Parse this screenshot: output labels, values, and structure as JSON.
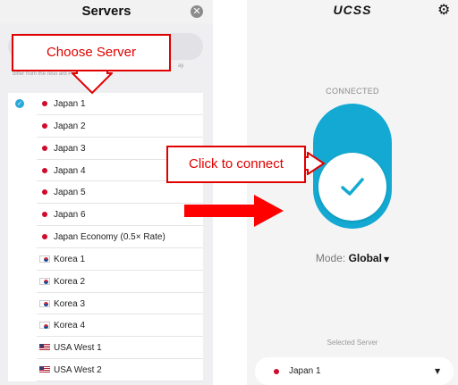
{
  "left_panel": {
    "title": "Servers",
    "close_glyph": "✕",
    "hint_line1_end": "ay",
    "hint_line2": "differ from the resu          ard Ping tests."
  },
  "servers": [
    {
      "name": "Japan 1",
      "flag": "jp",
      "selected": true
    },
    {
      "name": "Japan 2",
      "flag": "jp",
      "selected": false
    },
    {
      "name": "Japan 3",
      "flag": "jp",
      "selected": false
    },
    {
      "name": "Japan 4",
      "flag": "jp",
      "selected": false
    },
    {
      "name": "Japan 5",
      "flag": "jp",
      "selected": false
    },
    {
      "name": "Japan 6",
      "flag": "jp",
      "selected": false
    },
    {
      "name": "Japan Economy (0.5× Rate)",
      "flag": "jp",
      "selected": false
    },
    {
      "name": "Korea 1",
      "flag": "kr",
      "selected": false
    },
    {
      "name": "Korea 2",
      "flag": "kr",
      "selected": false
    },
    {
      "name": "Korea 3",
      "flag": "kr",
      "selected": false
    },
    {
      "name": "Korea 4",
      "flag": "kr",
      "selected": false
    },
    {
      "name": "USA West 1",
      "flag": "us",
      "selected": false
    },
    {
      "name": "USA West 2",
      "flag": "us",
      "selected": false
    }
  ],
  "right_panel": {
    "brand": "UCSS",
    "status": "CONNECTED",
    "mode_label": "Mode:",
    "mode_value": "Global",
    "selected_server_label": "Selected Server",
    "selected_server_name": "Japan 1"
  },
  "callouts": {
    "choose_server": "Choose Server",
    "click_to_connect": "Click to connect"
  },
  "colors": {
    "accent": "#13a9d2",
    "annotation": "#e00000"
  },
  "icons": {
    "settings": "gear-icon",
    "close": "close-icon",
    "check": "check-icon",
    "dropdown": "chevron-down-icon"
  }
}
